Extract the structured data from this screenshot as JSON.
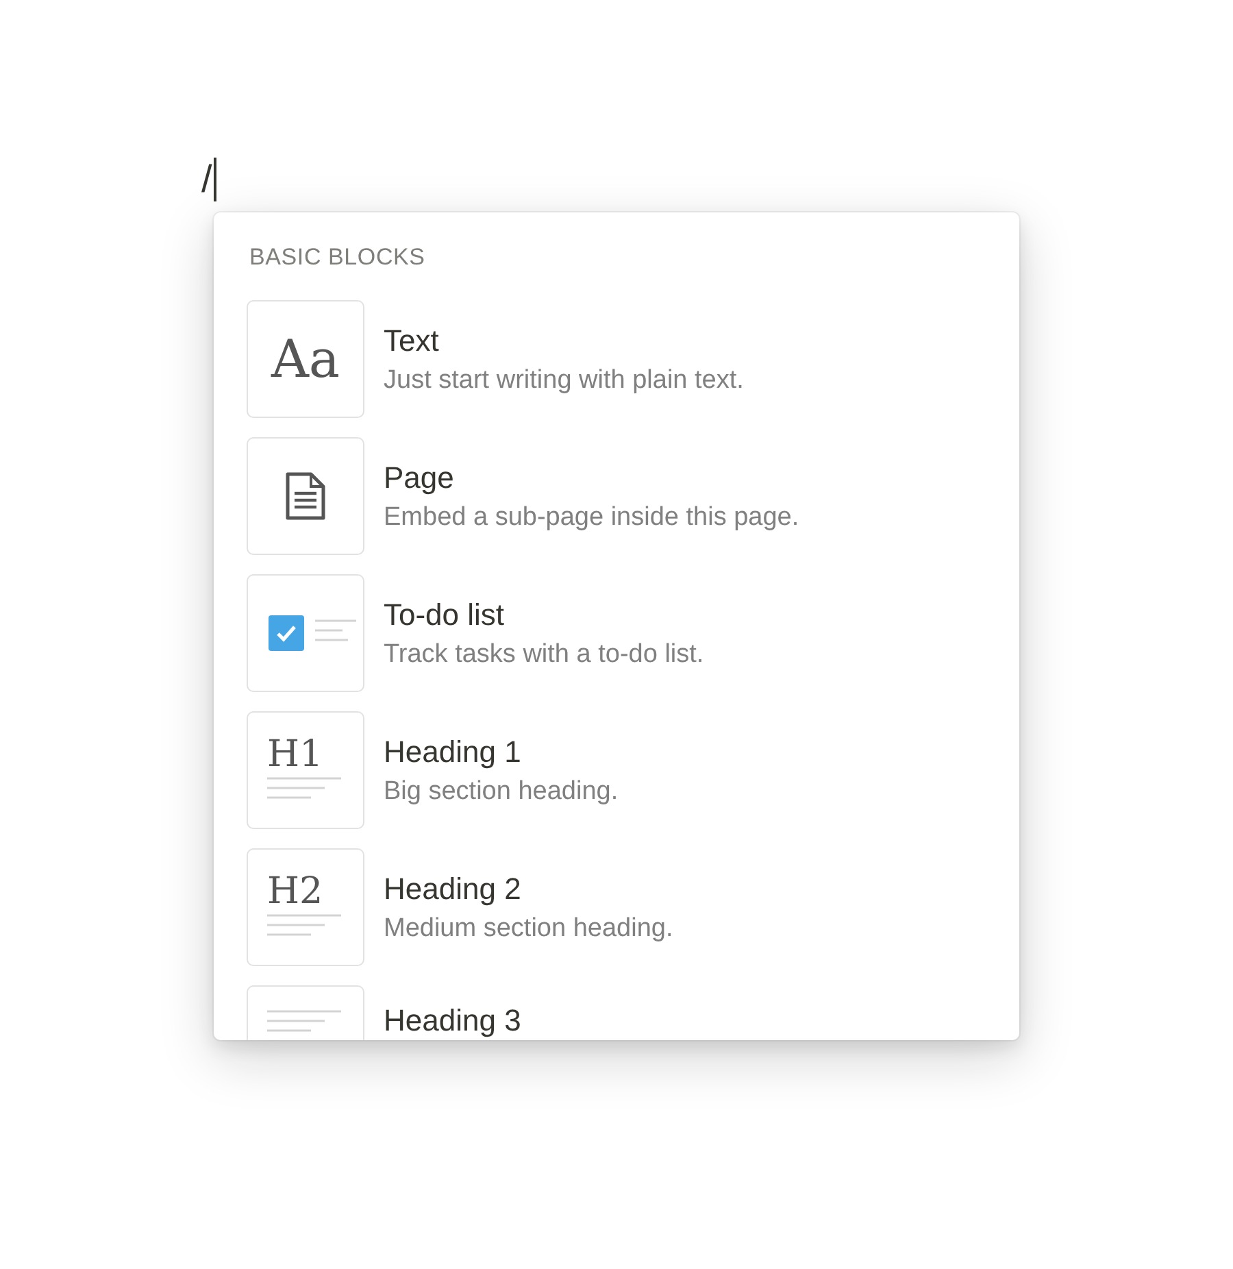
{
  "editor": {
    "typed": "/"
  },
  "menu": {
    "section": "BASIC BLOCKS",
    "items": [
      {
        "kind": "text",
        "glyph": "Aa",
        "title": "Text",
        "description": "Just start writing with plain text."
      },
      {
        "kind": "page",
        "title": "Page",
        "description": "Embed a sub-page inside this page."
      },
      {
        "kind": "todo",
        "checked": true,
        "title": "To-do list",
        "description": "Track tasks with a to-do list."
      },
      {
        "kind": "heading",
        "glyph": "H1",
        "title": "Heading 1",
        "description": "Big section heading."
      },
      {
        "kind": "heading",
        "glyph": "H2",
        "title": "Heading 2",
        "description": "Medium section heading."
      },
      {
        "kind": "heading",
        "title": "Heading 3"
      }
    ]
  }
}
